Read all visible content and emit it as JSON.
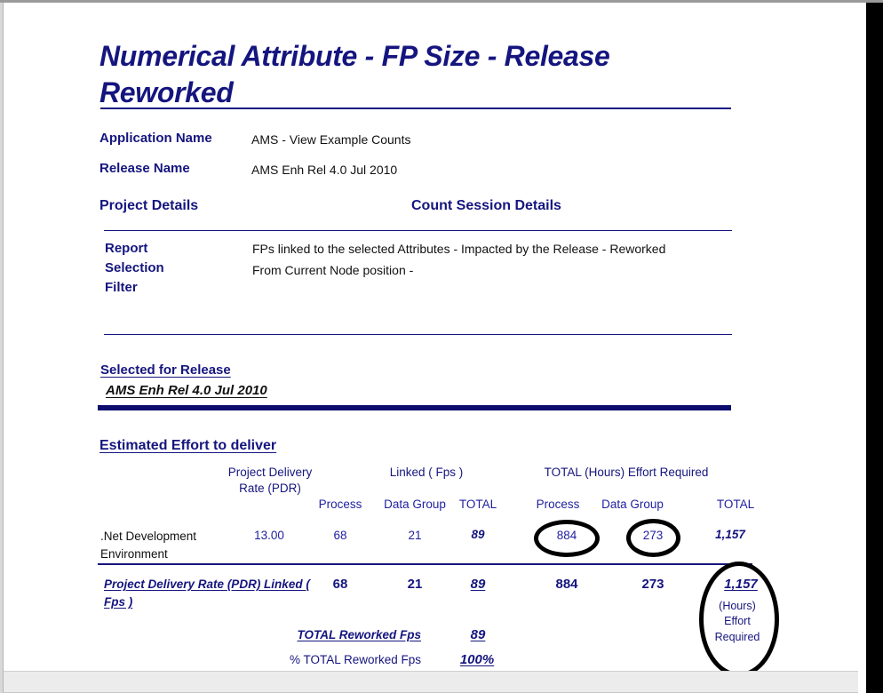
{
  "report": {
    "title": "Numerical Attribute - FP Size - Release Reworked",
    "fields": [
      {
        "label": "Application Name",
        "value": "AMS -  View  Example Counts"
      },
      {
        "label": "Release Name",
        "value": "AMS Enh Rel 4.0 Jul 2010"
      }
    ],
    "section_headers": {
      "project_details": "Project Details",
      "count_session_details": "Count Session Details"
    },
    "filter": {
      "label": "Report Selection Filter",
      "line1": "FPs linked to the selected Attributes  - Impacted by the Release -",
      "line2": "Reworked",
      "line3": "From Current Node position -"
    },
    "selected_for_release": {
      "heading": "Selected for Release",
      "value": "AMS Enh Rel 4.0 Jul 2010"
    },
    "estimated_effort": {
      "heading": "Estimated Effort to deliver",
      "group_headers": {
        "pdr": "Project Delivery Rate (PDR)",
        "pdr_line1": "Project Delivery",
        "pdr_line2": "Rate (PDR)",
        "linked": "Linked  ( Fps )",
        "total_effort": "TOTAL  (Hours)  Effort Required"
      },
      "sub_headers": {
        "linked_process": "Process",
        "linked_data_group": "Data Group",
        "linked_total": "TOTAL",
        "effort_process": "Process",
        "effort_data_group": "Data Group",
        "effort_total": "TOTAL"
      },
      "rows": [
        {
          "label_line1": ".Net Development",
          "label_line2": "Environment",
          "pdr": "13.00",
          "linked_process": "68",
          "linked_data_group": "21",
          "linked_total": "89",
          "effort_process": "884",
          "effort_data_group": "273",
          "effort_total": "1,157"
        }
      ],
      "totals_row": {
        "label_line1": "Project Delivery Rate (PDR) Linked  (",
        "label_line2": "Fps )",
        "linked_process": "68",
        "linked_data_group": "21",
        "linked_total": "89",
        "effort_process": "884",
        "effort_data_group": "273",
        "effort_total": "1,157"
      },
      "summary_rows": [
        {
          "label": "TOTAL  Reworked Fps",
          "value": "89"
        },
        {
          "label": "% TOTAL  Reworked Fps",
          "value": "100%"
        }
      ],
      "callout": {
        "value": "1,157",
        "note_line1": "(Hours)",
        "note_line2": "Effort",
        "note_line3": "Required"
      }
    }
  },
  "colors": {
    "navy_text": "#15157f",
    "value_blue": "#1f1fa0",
    "rule_navy": "#0d0d6e",
    "annotation_black": "#000000",
    "body_black": "#111111"
  }
}
